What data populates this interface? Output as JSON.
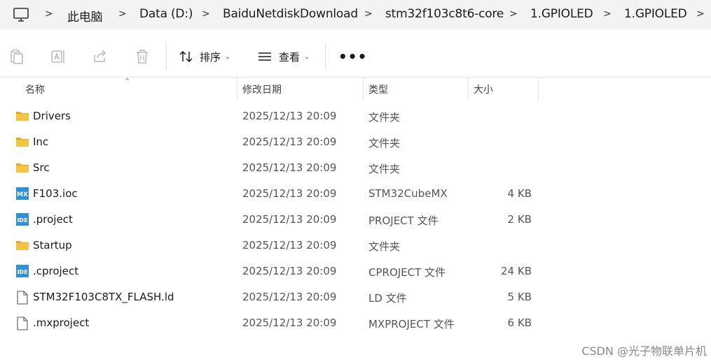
{
  "breadcrumb": {
    "icon": "computer-icon",
    "items": [
      "此电脑",
      "Data (D:)",
      "BaiduNetdiskDownload",
      "stm32f103c8t6-core",
      "1.GPIOLED",
      "1.GPIOLED"
    ]
  },
  "toolbar": {
    "sort_label": "排序",
    "view_label": "查看",
    "more_label": "•••"
  },
  "columns": {
    "name": "名称",
    "date": "修改日期",
    "type": "类型",
    "size": "大小"
  },
  "files": [
    {
      "name": "Drivers",
      "date": "2025/12/13 20:09",
      "type": "文件夹",
      "size": "",
      "icon": "folder-icon"
    },
    {
      "name": "Inc",
      "date": "2025/12/13 20:09",
      "type": "文件夹",
      "size": "",
      "icon": "folder-icon"
    },
    {
      "name": "Src",
      "date": "2025/12/13 20:09",
      "type": "文件夹",
      "size": "",
      "icon": "folder-icon"
    },
    {
      "name": "F103.ioc",
      "date": "2025/12/13 20:09",
      "type": "STM32CubeMX",
      "size": "4 KB",
      "icon": "mx-file-icon"
    },
    {
      "name": ".project",
      "date": "2025/12/13 20:09",
      "type": "PROJECT 文件",
      "size": "2 KB",
      "icon": "ide-file-icon"
    },
    {
      "name": "Startup",
      "date": "2025/12/13 20:09",
      "type": "文件夹",
      "size": "",
      "icon": "folder-icon"
    },
    {
      "name": ".cproject",
      "date": "2025/12/13 20:09",
      "type": "CPROJECT 文件",
      "size": "24 KB",
      "icon": "ide-file-icon"
    },
    {
      "name": "STM32F103C8TX_FLASH.ld",
      "date": "2025/12/13 20:09",
      "type": "LD 文件",
      "size": "5 KB",
      "icon": "file-icon"
    },
    {
      "name": ".mxproject",
      "date": "2025/12/13 20:09",
      "type": "MXPROJECT 文件",
      "size": "6 KB",
      "icon": "file-icon"
    }
  ],
  "icon_labels": {
    "mx": "MX",
    "ide": "IDE"
  },
  "watermark": "CSDN @光子物联单片机",
  "colors": {
    "folder": "#f4c542",
    "folder_dark": "#e0a72a",
    "app_icon": "#2f8fd8",
    "breadcrumb_bg": "#f3f3f3"
  }
}
